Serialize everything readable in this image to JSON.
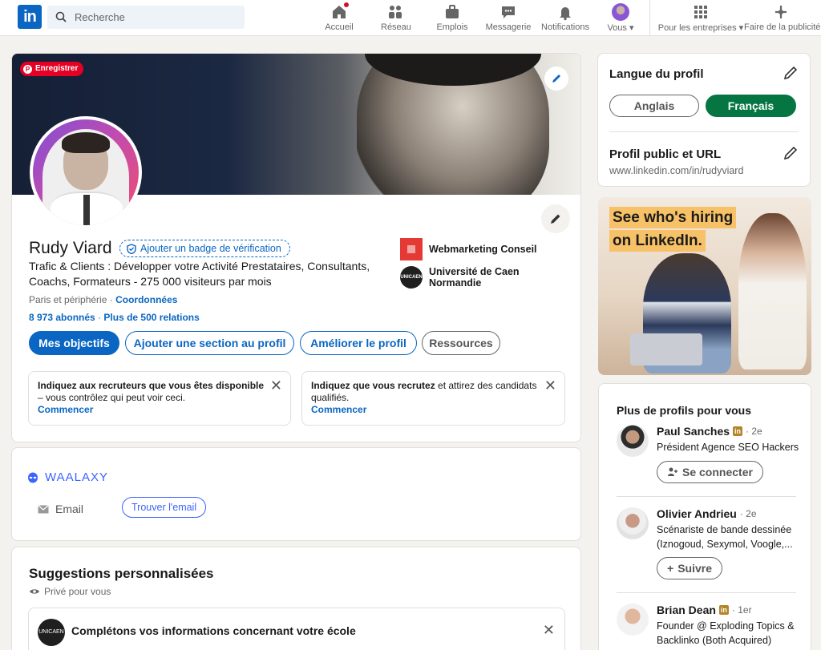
{
  "nav": {
    "search_placeholder": "Recherche",
    "items": [
      {
        "label": "Accueil",
        "icon": "home-icon"
      },
      {
        "label": "Réseau",
        "icon": "network-icon"
      },
      {
        "label": "Emplois",
        "icon": "jobs-icon"
      },
      {
        "label": "Messagerie",
        "icon": "messaging-icon"
      },
      {
        "label": "Notifications",
        "icon": "bell-icon"
      },
      {
        "label": "Vous",
        "icon": "avatar"
      },
      {
        "label": "Pour les entreprises",
        "icon": "grid-icon"
      },
      {
        "label": "Faire de la publicité",
        "icon": "ads-icon"
      }
    ]
  },
  "profile": {
    "save_pin": "Enregistrer",
    "name": "Rudy Viard",
    "verify_badge": "Ajouter un badge de vérification",
    "headline": "Trafic & Clients : Développer votre Activité Prestataires, Consultants, Coachs, Formateurs - 275 000 visiteurs par mois",
    "location": "Paris et périphérie",
    "location_sep": "·",
    "contact_link": "Coordonnées",
    "followers": "8 973 abonnés",
    "stats_sep": "·",
    "connections": "Plus de 500 relations",
    "experience": [
      {
        "name": "Webmarketing Conseil"
      },
      {
        "name": "Université de Caen Normandie"
      }
    ],
    "buttons": {
      "objectives": "Mes objectifs",
      "add_section": "Ajouter une section au profil",
      "improve": "Améliorer le profil",
      "resources": "Ressources"
    },
    "open_to_work": {
      "bold": "Indiquez aux recruteurs que vous êtes disponible",
      "text": " – vous contrôlez qui peut voir ceci.",
      "link": "Commencer"
    },
    "hiring": {
      "bold": "Indiquez que vous recrutez",
      "text": " et attirez des candidats qualifiés.",
      "link": "Commencer"
    }
  },
  "waalaxy": {
    "brand": "WAALAXY",
    "email_label": "Email",
    "find_email": "Trouver l'email"
  },
  "suggestions": {
    "title": "Suggestions personnalisées",
    "private": "Privé pour vous",
    "item_text": "Complétons vos informations concernant votre école",
    "school_logo_text": "UNICAEN"
  },
  "right": {
    "language_title": "Langue du profil",
    "lang_en": "Anglais",
    "lang_fr": "Français",
    "public_title": "Profil public et URL",
    "public_url": "www.linkedin.com/in/rudyviard",
    "ad_line1": "See who's hiring",
    "ad_line2": "on LinkedIn.",
    "more_profiles_title": "Plus de profils pour vous",
    "people": [
      {
        "name": "Paul Sanches",
        "degree": "· 2e",
        "desc": "Président Agence SEO Hackers",
        "action": "Se connecter",
        "premium": true
      },
      {
        "name": "Olivier Andrieu",
        "degree": "· 2e",
        "desc": "Scénariste de bande dessinée (Iznogoud, Sexymol, Voogle,...",
        "action": "Suivre",
        "premium": false
      },
      {
        "name": "Brian Dean",
        "degree": "· 1er",
        "desc": "Founder @ Exploding Topics & Backlinko (Both Acquired)",
        "action": "",
        "premium": true
      }
    ]
  },
  "colors": {
    "linkedin_blue": "#0a66c2",
    "pinterest_red": "#e60023",
    "green_selected": "#057642",
    "waalaxy_blue": "#3b63ff",
    "ad_yellow": "#f7c167"
  }
}
